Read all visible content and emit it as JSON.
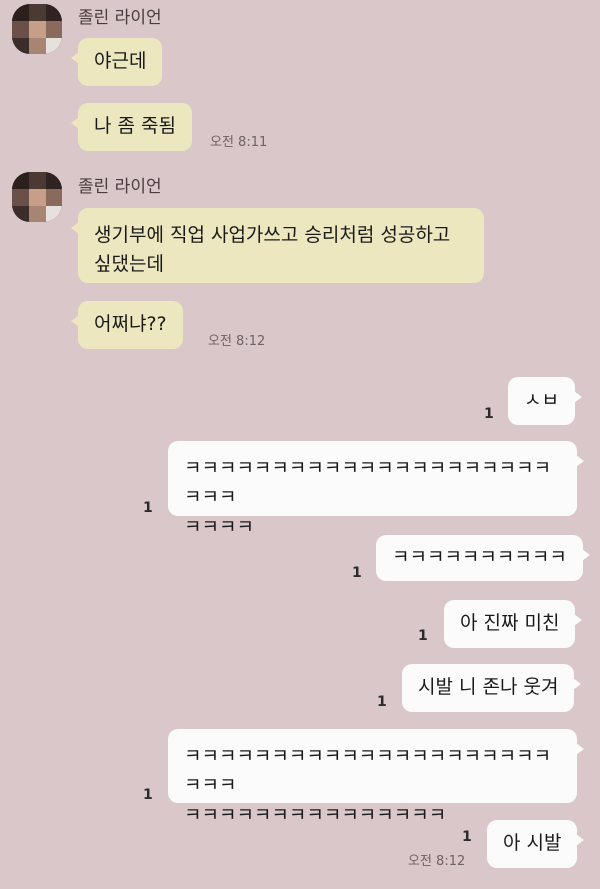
{
  "sender_name": "졸린 라이언",
  "incoming_1": {
    "messages": [
      "야근데",
      "나 좀 죽됨"
    ],
    "time": "오전 8:11"
  },
  "incoming_2": {
    "messages": [
      "생기부에 직업 사업가쓰고 승리처럼 성공하고\n싶댔는데",
      "어쩌냐??"
    ],
    "time": "오전 8:12"
  },
  "outgoing": [
    {
      "text": "ㅅㅂ",
      "read": "1"
    },
    {
      "text": "ㅋㅋㅋㅋㅋㅋㅋㅋㅋㅋㅋㅋㅋㅋㅋㅋㅋㅋㅋㅋㅋㅋㅋㅋ\nㅋㅋㅋㅋ",
      "read": "1"
    },
    {
      "text": "ㅋㅋㅋㅋㅋㅋㅋㅋㅋㅋ",
      "read": "1"
    },
    {
      "text": "아 진짜 미친",
      "read": "1"
    },
    {
      "text": "시발 니 존나 웃겨",
      "read": "1"
    },
    {
      "text": "ㅋㅋㅋㅋㅋㅋㅋㅋㅋㅋㅋㅋㅋㅋㅋㅋㅋㅋㅋㅋㅋㅋㅋㅋ\nㅋㅋㅋㅋㅋㅋㅋㅋㅋㅋㅋㅋㅋㅋㅋ",
      "read": "1"
    },
    {
      "text": "아 시발",
      "read": "1",
      "time": "오전 8:12"
    }
  ]
}
